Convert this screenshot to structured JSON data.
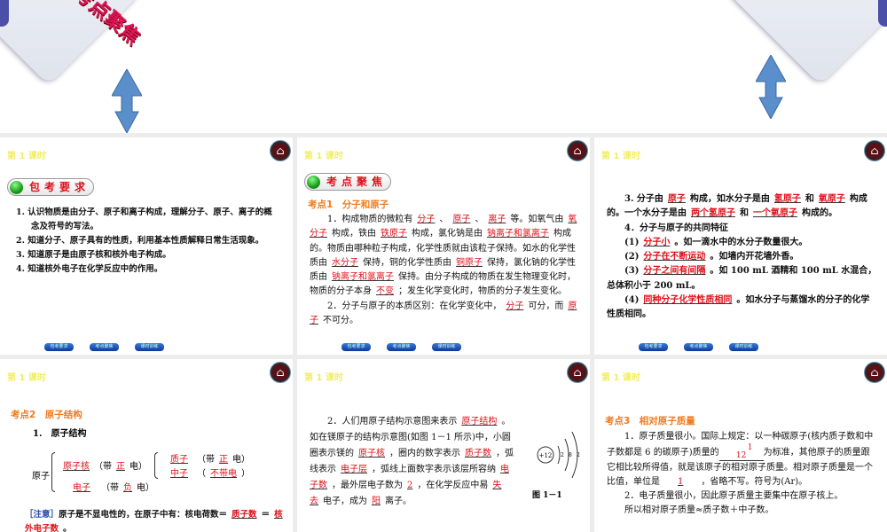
{
  "banner": {
    "title": "考点聚焦"
  },
  "lesson": "第 1 课时",
  "nav": [
    "包考要求",
    "考点聚焦",
    "课时训练"
  ],
  "p1": {
    "badge": "包考要求",
    "items": [
      "1. 认识物质是由分子、原子和离子构成，理解分子、原子、离子的概念及符号的写法。",
      "2. 知道分子、原子具有的性质，利用基本性质解释日常生活现象。",
      "3. 知道原子是由原子核和核外电子构成。",
      "4. 知道核外电子在化学反应中的作用。"
    ]
  },
  "p2": {
    "badge": "考点聚焦",
    "heading": "考点1　分子和原子",
    "paras": [
      [
        "1．构成物质的微粒有",
        {
          "a": "分子"
        },
        "、",
        {
          "a": "原子"
        },
        "、",
        {
          "a": "离子"
        },
        "等。如氧气由",
        {
          "a": "氧分子"
        },
        "构成，铁由",
        {
          "a": "铁原子"
        },
        "构成，氯化钠是由",
        {
          "a": "钠离子和氯离子"
        },
        "构成的。物质由哪种粒子构成，化学性质就由该粒子保持。如水的化学性质由",
        {
          "a": "水分子"
        },
        "保持，铜的化学性质由",
        {
          "a": "铜原子"
        },
        "保持，氯化钠的化学性质由",
        {
          "a": "钠离子和氯离子"
        },
        "保持。由分子构成的物质在发生物理变化时，物质的分子本身",
        {
          "a": "不变"
        },
        "；发生化学变化时，物质的分子发生变化。"
      ],
      [
        "2．分子与原子的本质区别：在化学变化中，",
        {
          "a": "分子"
        },
        "可分，而",
        {
          "a": "原子"
        },
        "不可分。"
      ]
    ]
  },
  "p3": {
    "paras": [
      [
        "3. 分子由",
        {
          "a": "原子"
        },
        "构成，如水分子是由",
        {
          "a": "氢原子"
        },
        "和",
        {
          "a": "氧原子"
        },
        "构成的。一个水分子是由",
        {
          "a": "两个氢原子"
        },
        "和",
        {
          "a": "一个氧原子"
        },
        "构成的。"
      ],
      [
        "4．分子与原子的共同特征"
      ],
      [
        "(1)",
        {
          "a": "分子小"
        },
        "。如一滴水中的水分子数量很大。"
      ],
      [
        "(2)",
        {
          "a": "分子在不断运动"
        },
        "。如墙内开花墙外香。"
      ],
      [
        "(3)",
        {
          "a": "分子之间有间隔"
        },
        "。如 100 mL 酒精和 100 mL 水混合，总体积小于 200 mL。"
      ],
      [
        "(4)",
        {
          "a": "同种分子化学性质相同"
        },
        "。如水分子与蒸馏水的分子的化学性质相同。"
      ]
    ]
  },
  "p4": {
    "heading": "考点2　原子结构",
    "sub": "1.　原子结构",
    "atom": "原子",
    "nucleus": "原子核",
    "electron": "电子",
    "proton": "质子",
    "neutron": "中子",
    "charge_pos": "正",
    "charge_neg": "负",
    "neutral": "不带电",
    "dai": "（带",
    "dian": "电）",
    "lp": "（",
    "rp": "）",
    "note": [
      "［注意］",
      "原子是不显电性的，在原子中有：核电荷数＝",
      {
        "a": "质子数"
      },
      "＝",
      {
        "a": "核外电子数"
      },
      "。"
    ]
  },
  "p5": {
    "paras": [
      [
        "2．人们用原子结构示意图来表示",
        {
          "a": "原子结构"
        },
        "。如在镁原子的结构示意图(如图 1－1 所示)中，小圆圈表示镁的",
        {
          "a": "原子核"
        },
        "，圈内的数字表示",
        {
          "a": "质子数"
        },
        "，弧线表示",
        {
          "a": "电子层"
        },
        "，弧线上面数字表示该层所容纳",
        {
          "a": "电子数"
        },
        "，最外层电子数为",
        {
          "a": "2"
        },
        "，在化学反应中易",
        {
          "a": "失去"
        },
        "电子，成为",
        {
          "a": "阳"
        },
        "离子。"
      ]
    ],
    "nucleus": "+12",
    "shells": [
      "2",
      "8",
      "2"
    ],
    "caption": "图 1－1"
  },
  "p6": {
    "heading": "考点3　相对原子质量",
    "a": [
      "1．原子质量很小。国际上规定：以一种碳原子(核内质子数和中子数都是 6 的碳原子)质量的"
    ],
    "frac_num": "1",
    "frac_den": "12",
    "b": "为标准，其他原子的质量跟它相比较所得值，就是该原子的相对原子质量。相对原子质量是一个比值，单位是",
    "unit": "1",
    "c": "，省略不写。符号为(Ar)。",
    "d": "2．电子质量很小，因此原子质量主要集中在原子核上。",
    "e": "所以相对原子质量≈质子数＋中子数。"
  }
}
